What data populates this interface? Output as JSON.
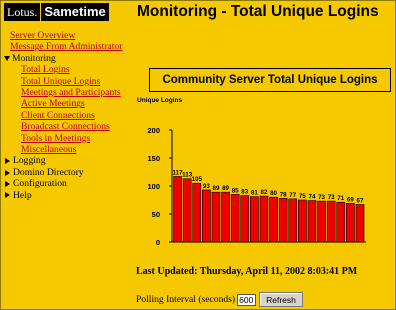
{
  "logo": {
    "lotus": "Lotus.",
    "product": "Sametime"
  },
  "page_title": "Monitoring - Total Unique Logins",
  "sidebar": {
    "server_overview": "Server Overview",
    "message_admin": "Message From Administrator",
    "monitoring": "Monitoring",
    "monitoring_items": [
      "Total Logins",
      "Total Unique Logins",
      "Meetings and Participants",
      "Active Meetings",
      "Client Connections",
      "Broadcast Connections",
      "Tools in Meetings",
      "Miscellaneous"
    ],
    "collapsed_sections": [
      "Logging",
      "Domino Directory",
      "Configuration",
      "Help"
    ]
  },
  "chart_title": "Community Server Total Unique Logins",
  "chart_data": {
    "type": "bar",
    "title": "Community Server Total Unique Logins",
    "ylabel": "Unique Logins",
    "xlabel": "",
    "ylim": [
      0,
      200
    ],
    "yticks": [
      0,
      50,
      100,
      150,
      200
    ],
    "values": [
      117,
      113,
      105,
      93,
      89,
      89,
      85,
      83,
      81,
      82,
      80,
      78,
      77,
      75,
      74,
      73,
      73,
      71,
      69,
      67
    ],
    "labels": [
      "117",
      "113",
      "105",
      "93",
      "89",
      "89",
      "85",
      "83",
      "81",
      "82",
      "80",
      "78",
      "77",
      "75",
      "74",
      "73",
      "73",
      "71",
      "69",
      "67"
    ],
    "bar_color": "#ee0000",
    "grid": false
  },
  "last_updated": "Last Updated: Thursday, April 11, 2002 8:03:41 PM",
  "polling": {
    "label": "Polling Interval (seconds)",
    "value": "600",
    "refresh_label": "Refresh"
  },
  "colors": {
    "background": "#f5c800",
    "link": "#c00000",
    "bar": "#ee0000"
  }
}
